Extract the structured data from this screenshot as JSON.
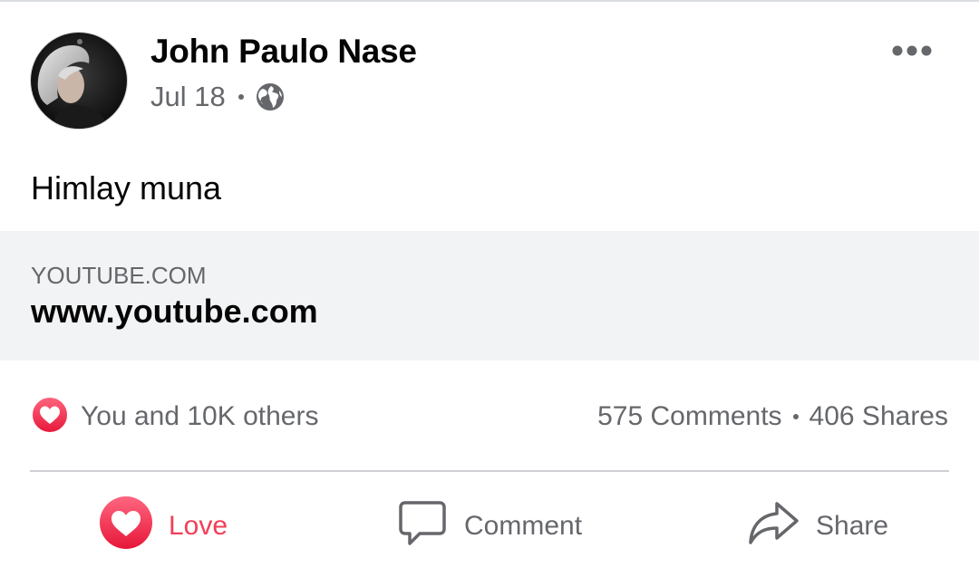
{
  "post": {
    "author": "John Paulo Nase",
    "date": "Jul 18",
    "privacy_icon": "globe-icon",
    "more_icon": "more-options-icon",
    "text": "Himlay muna"
  },
  "link_preview": {
    "domain": "YOUTUBE.COM",
    "title": "www.youtube.com"
  },
  "stats": {
    "reaction_icon": "love-reaction-icon",
    "reactions_text": "You and 10K others",
    "comments": "575 Comments",
    "shares": "406 Shares"
  },
  "actions": {
    "love": "Love",
    "comment": "Comment",
    "share": "Share"
  },
  "colors": {
    "love_accent": "#f33e58",
    "secondary_text": "#65676b",
    "preview_background": "#f2f3f5"
  }
}
